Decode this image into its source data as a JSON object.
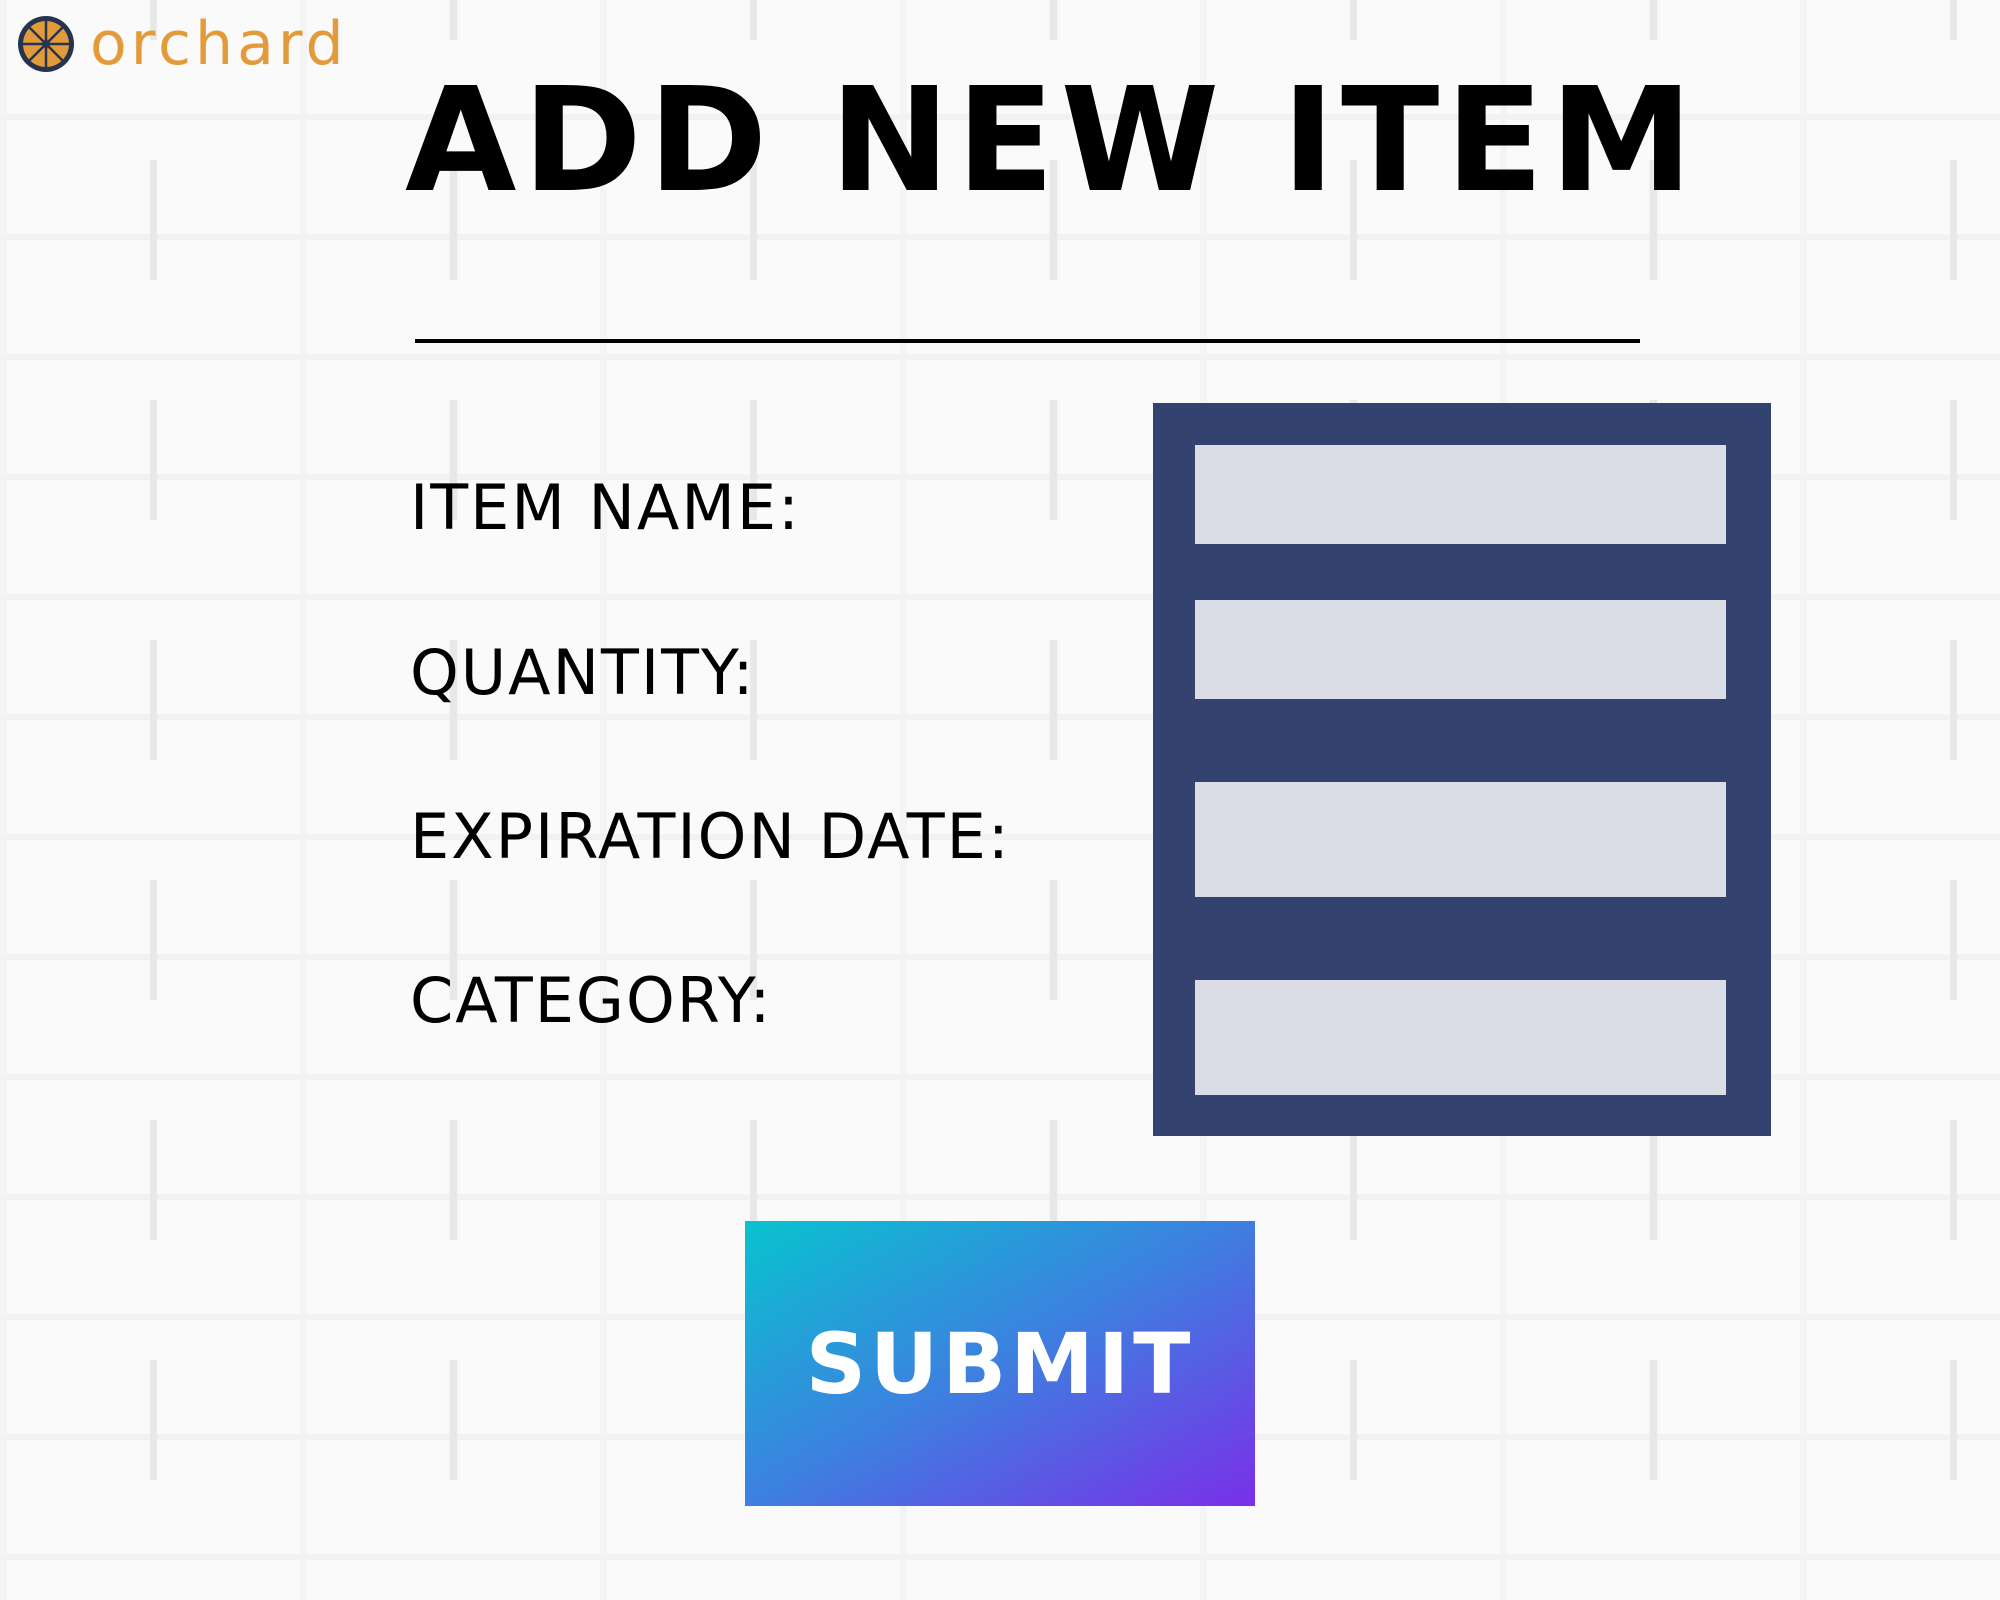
{
  "brand": {
    "name": "orchard",
    "icon": "orange-slice-icon",
    "color": "#e39a3b"
  },
  "header": {
    "title": "ADD NEW ITEM"
  },
  "form": {
    "fields": [
      {
        "label": "ITEM NAME:",
        "value": "",
        "placeholder": ""
      },
      {
        "label": "QUANTITY:",
        "value": "",
        "placeholder": ""
      },
      {
        "label": "EXPIRATION DATE:",
        "value": "",
        "placeholder": ""
      },
      {
        "label": "CATEGORY:",
        "value": "",
        "placeholder": ""
      }
    ],
    "panel_color": "#33426e",
    "submit_label": "SUBMIT"
  },
  "colors": {
    "button_gradient_start": "#08c3cf",
    "button_gradient_end": "#7a2fe8",
    "text": "#000000"
  }
}
